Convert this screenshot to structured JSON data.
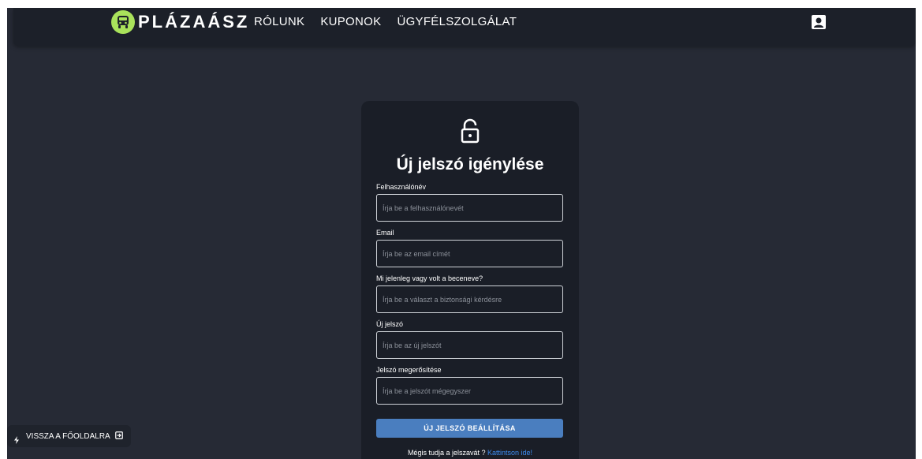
{
  "header": {
    "brand": "PLÁZAÁSZ",
    "nav": [
      "RÓLUNK",
      "KUPONOK",
      "ÜGYFÉLSZOLGÁLAT"
    ],
    "logo_icon": "car-logo-icon",
    "user_icon": "user-profile-icon"
  },
  "form": {
    "title": "Új jelszó igénylése",
    "icon": "unlocked-lock-icon",
    "fields": [
      {
        "label": "Felhasználónév",
        "placeholder": "Írja be a felhasználónevét"
      },
      {
        "label": "Email",
        "placeholder": "Írja be az email címét"
      },
      {
        "label": "Mi jelenleg vagy volt a beceneve?",
        "placeholder": "Írja be a választ a biztonsági kérdésre"
      },
      {
        "label": "Új jelszó",
        "placeholder": "Írja be az új jelszót"
      },
      {
        "label": "Jelszó megerősítése",
        "placeholder": "Írja be a jelszót mégegyszer"
      }
    ],
    "submit_label": "ÚJ JELSZÓ BEÁLLÍTÁSA",
    "footer_text": "Mégis tudja a jelszavát ?",
    "footer_link": "Kattintson ide!"
  },
  "back": {
    "label": "VISSZA A FŐOLDALRA"
  },
  "colors": {
    "background": "#262a35",
    "card": "#1a1e27",
    "accent": "#a9e25b",
    "button": "#4a7ebf",
    "link": "#3d8cf0"
  }
}
